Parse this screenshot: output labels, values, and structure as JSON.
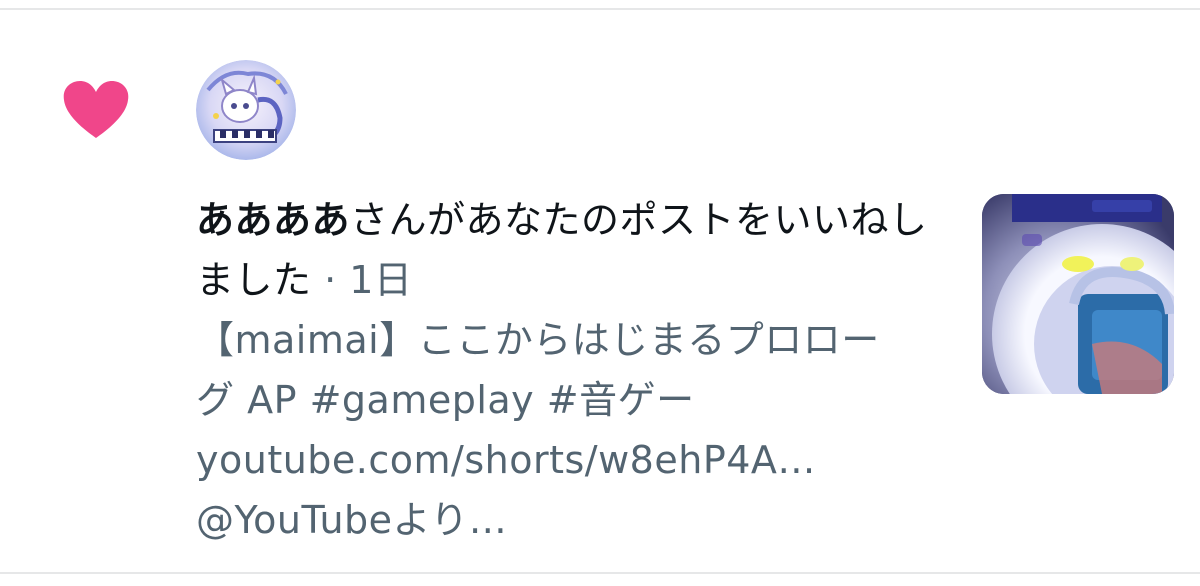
{
  "notification": {
    "type_icon": "heart-icon",
    "accent_color": "#f0468a",
    "avatar_icon": "avatar-icon",
    "user_name": "ああああ",
    "action_text": "さんがあなたのポストをいいねしました",
    "time_separator": "·",
    "time": "1日",
    "post": {
      "line_1": "【maimai】ここからはじまるプロロー",
      "line_2": "グ AP #gameplay #音ゲー",
      "line_3": "youtube.com/shorts/w8ehP4A…",
      "line_4": "@YouTubeより…"
    },
    "thumbnail_icon": "video-thumbnail"
  },
  "colors": {
    "text_primary": "#0f1419",
    "text_secondary": "#536471",
    "divider": "#e6e7e8",
    "heart": "#f0468a"
  }
}
